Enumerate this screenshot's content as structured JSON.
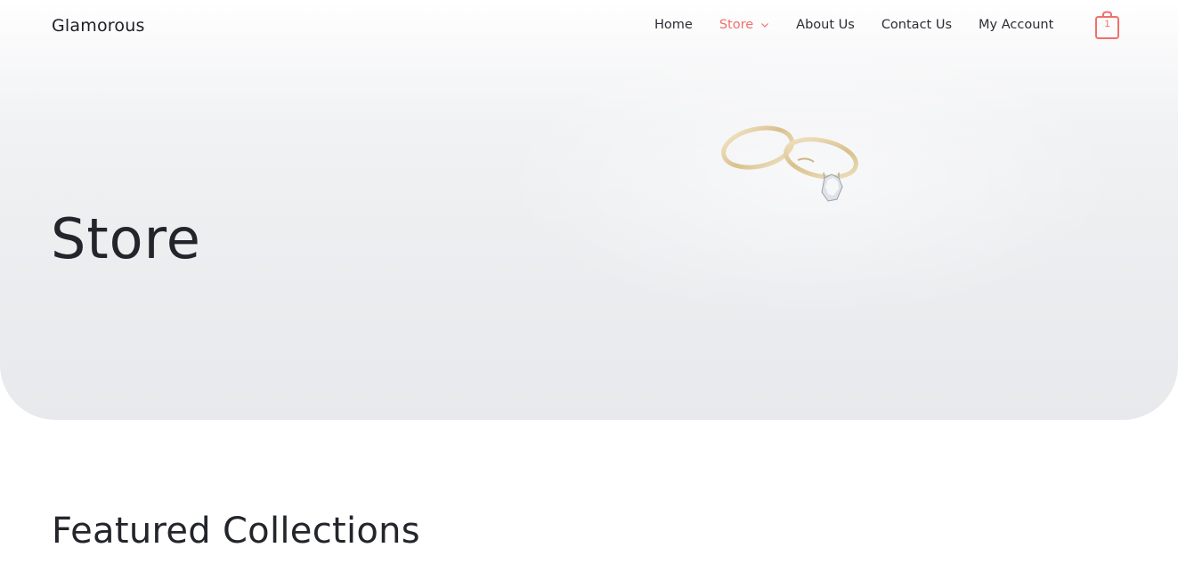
{
  "header": {
    "site_title": "Glamorous",
    "nav": [
      {
        "label": "Home"
      },
      {
        "label": "Store",
        "active": true,
        "has_dropdown": true
      },
      {
        "label": "About Us"
      },
      {
        "label": "Contact Us"
      },
      {
        "label": "My Account"
      }
    ],
    "cart_count": "1",
    "cart_icon": "shopping-bag-icon"
  },
  "hero": {
    "title": "Store",
    "image": "wedding-rings-photo"
  },
  "main": {
    "section_heading": "Featured Collections"
  },
  "colors": {
    "accent": "#f0706b",
    "text": "#23252b",
    "hero_bg": "#eceef0"
  }
}
